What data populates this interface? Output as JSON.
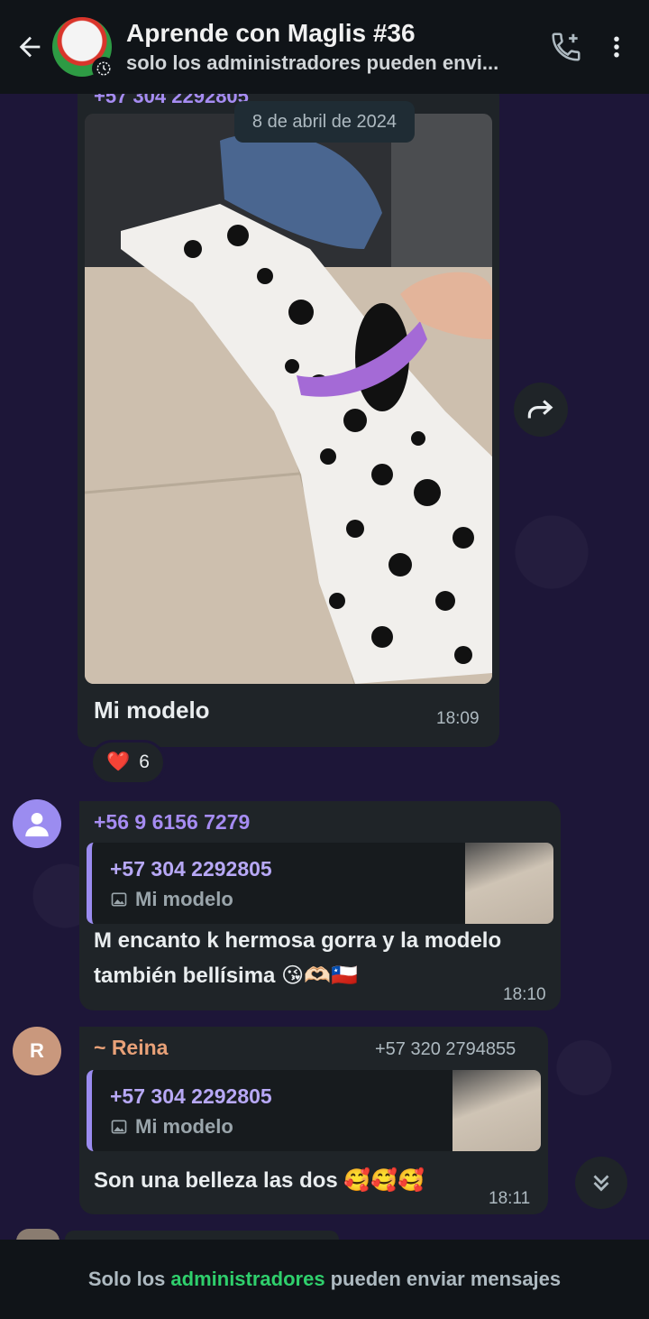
{
  "header": {
    "title": "Aprende con Maglis #36",
    "subtitle": "solo los administradores pueden envi..."
  },
  "date_separator": "8 de abril de 2024",
  "messages": [
    {
      "sender_phone_partial": "+57 304 2292805",
      "caption": "Mi modelo",
      "time": "18:09",
      "reaction": {
        "emoji": "❤️",
        "count": "6"
      }
    },
    {
      "sender": "+56 9 6156 7279",
      "sender_color": "#a68cf2",
      "quote": {
        "name": "+57 304 2292805",
        "text": "Mi modelo"
      },
      "text_line1": "M encanto k hermosa gorra y la modelo",
      "text_line2": "también bellísima 😘🫶🏻🇨🇱",
      "time": "18:10"
    },
    {
      "sender": "~ Reina",
      "sender_color": "#e8a178",
      "sender_phone": "+57 320 2794855",
      "avatar_letter": "R",
      "quote": {
        "name": "+57 304 2292805",
        "text": "Mi modelo"
      },
      "text": "Son una belleza las dos 🥰🥰🥰",
      "time": "18:11"
    }
  ],
  "footer": {
    "prefix": "Solo los",
    "link": "administradores",
    "suffix": "pueden enviar mensajes"
  }
}
